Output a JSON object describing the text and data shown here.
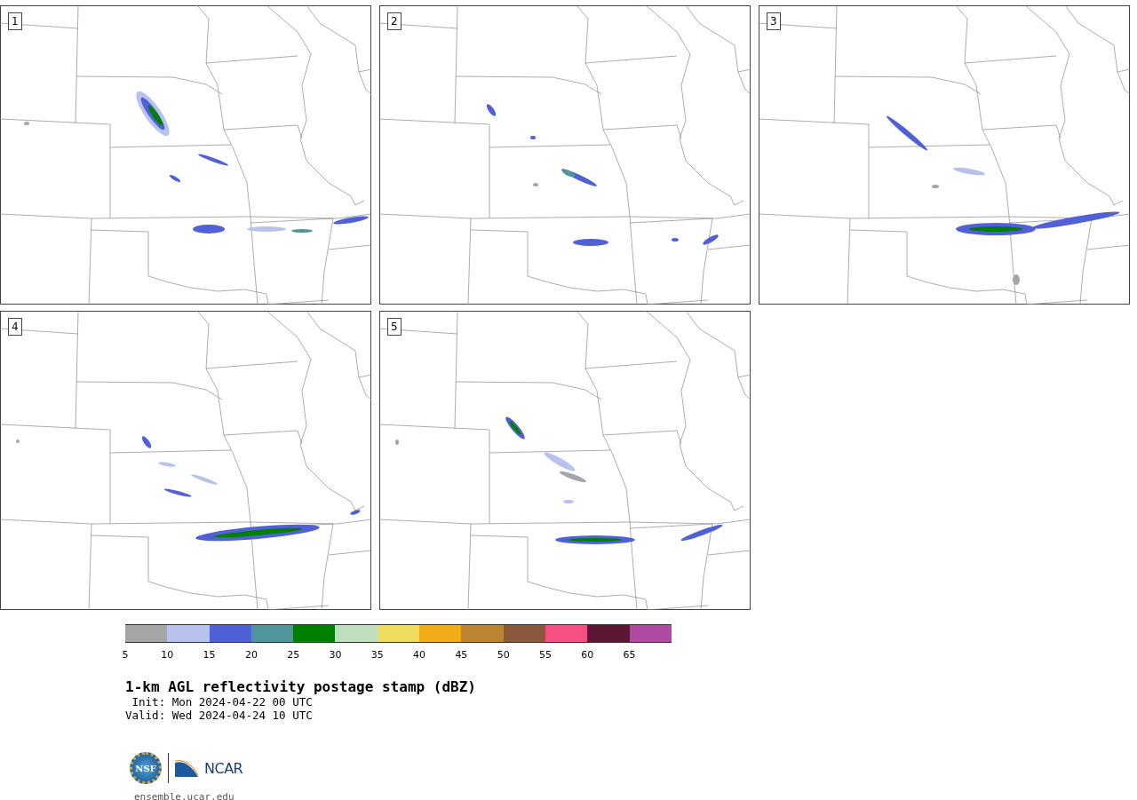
{
  "panels": [
    {
      "label": "1"
    },
    {
      "label": "2"
    },
    {
      "label": "3"
    },
    {
      "label": "4"
    },
    {
      "label": "5"
    }
  ],
  "colorbar": {
    "segments": [
      {
        "color": "#a5a5a5",
        "tick": "5"
      },
      {
        "color": "#b7c3ee",
        "tick": "10"
      },
      {
        "color": "#5060d6",
        "tick": "15"
      },
      {
        "color": "#4f959b",
        "tick": "20"
      },
      {
        "color": "#008000",
        "tick": "25"
      },
      {
        "color": "#bedfc0",
        "tick": "30"
      },
      {
        "color": "#efdb5e",
        "tick": "35"
      },
      {
        "color": "#f1ad17",
        "tick": "40"
      },
      {
        "color": "#bb8431",
        "tick": "45"
      },
      {
        "color": "#8b5a3c",
        "tick": "50"
      },
      {
        "color": "#f45082",
        "tick": "55"
      },
      {
        "color": "#5c1734",
        "tick": "60"
      },
      {
        "color": "#ad4aa2",
        "tick": "65"
      }
    ]
  },
  "title": "1-km AGL reflectivity postage stamp (dBZ)",
  "init": " Init: Mon 2024-04-22 00 UTC",
  "valid": "Valid: Wed 2024-04-24 10 UTC",
  "logo": {
    "nsf": "NSF",
    "ncar": "NCAR"
  },
  "footer": "ensemble.ucar.edu"
}
